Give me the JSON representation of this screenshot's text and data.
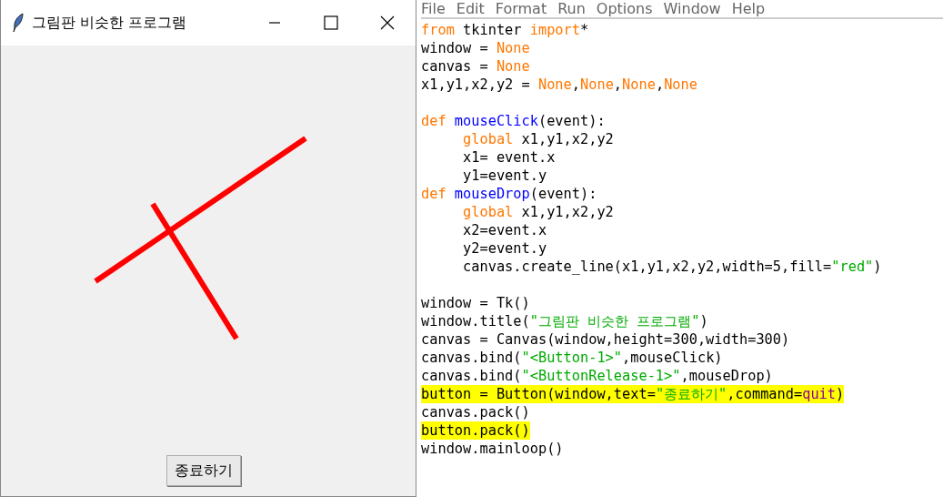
{
  "app_window": {
    "title": "그림판 비슷한 프로그램",
    "quit_button": "종료하기"
  },
  "editor": {
    "menu": [
      "File",
      "Edit",
      "Format",
      "Run",
      "Options",
      "Window",
      "Help"
    ],
    "lines": [
      {
        "kind": "code",
        "highlighted": false,
        "tokens": [
          {
            "kind": "keyword",
            "text": "from"
          },
          {
            "kind": "plain",
            "text": " tkinter "
          },
          {
            "kind": "keyword",
            "text": "import"
          },
          {
            "kind": "plain",
            "text": "*"
          }
        ]
      },
      {
        "kind": "code",
        "highlighted": false,
        "tokens": [
          {
            "kind": "plain",
            "text": "window = "
          },
          {
            "kind": "keyword",
            "text": "None"
          }
        ]
      },
      {
        "kind": "code",
        "highlighted": false,
        "tokens": [
          {
            "kind": "plain",
            "text": "canvas = "
          },
          {
            "kind": "keyword",
            "text": "None"
          }
        ]
      },
      {
        "kind": "code",
        "highlighted": false,
        "tokens": [
          {
            "kind": "plain",
            "text": "x1,y1,x2,y2 = "
          },
          {
            "kind": "keyword",
            "text": "None"
          },
          {
            "kind": "plain",
            "text": ","
          },
          {
            "kind": "keyword",
            "text": "None"
          },
          {
            "kind": "plain",
            "text": ","
          },
          {
            "kind": "keyword",
            "text": "None"
          },
          {
            "kind": "plain",
            "text": ","
          },
          {
            "kind": "keyword",
            "text": "None"
          }
        ]
      },
      {
        "kind": "blank"
      },
      {
        "kind": "code",
        "highlighted": false,
        "tokens": [
          {
            "kind": "keyword",
            "text": "def "
          },
          {
            "kind": "definition",
            "text": "mouseClick"
          },
          {
            "kind": "plain",
            "text": "(event):"
          }
        ]
      },
      {
        "kind": "code",
        "highlighted": false,
        "tokens": [
          {
            "kind": "keyword",
            "text": "     global"
          },
          {
            "kind": "plain",
            "text": " x1,y1,x2,y2"
          }
        ]
      },
      {
        "kind": "code",
        "highlighted": false,
        "tokens": [
          {
            "kind": "plain",
            "text": "     x1= event.x"
          }
        ]
      },
      {
        "kind": "code",
        "highlighted": false,
        "tokens": [
          {
            "kind": "plain",
            "text": "     y1=event.y"
          }
        ]
      },
      {
        "kind": "code",
        "highlighted": false,
        "tokens": [
          {
            "kind": "keyword",
            "text": "def "
          },
          {
            "kind": "definition",
            "text": "mouseDrop"
          },
          {
            "kind": "plain",
            "text": "(event):"
          }
        ]
      },
      {
        "kind": "code",
        "highlighted": false,
        "tokens": [
          {
            "kind": "keyword",
            "text": "     global"
          },
          {
            "kind": "plain",
            "text": " x1,y1,x2,y2"
          }
        ]
      },
      {
        "kind": "code",
        "highlighted": false,
        "tokens": [
          {
            "kind": "plain",
            "text": "     x2=event.x"
          }
        ]
      },
      {
        "kind": "code",
        "highlighted": false,
        "tokens": [
          {
            "kind": "plain",
            "text": "     y2=event.y"
          }
        ]
      },
      {
        "kind": "code",
        "highlighted": false,
        "tokens": [
          {
            "kind": "plain",
            "text": "     canvas.create_line(x1,y1,x2,y2,width=5,fill="
          },
          {
            "kind": "string",
            "text": "\"red\""
          },
          {
            "kind": "plain",
            "text": ")"
          }
        ]
      },
      {
        "kind": "blank"
      },
      {
        "kind": "code",
        "highlighted": false,
        "tokens": [
          {
            "kind": "plain",
            "text": "window = Tk()"
          }
        ]
      },
      {
        "kind": "code",
        "highlighted": false,
        "tokens": [
          {
            "kind": "plain",
            "text": "window.title("
          },
          {
            "kind": "string",
            "text": "\"그림판 비슷한 프로그램\""
          },
          {
            "kind": "plain",
            "text": ")"
          }
        ]
      },
      {
        "kind": "code",
        "highlighted": false,
        "tokens": [
          {
            "kind": "plain",
            "text": "canvas = Canvas(window,height=300,width=300)"
          }
        ]
      },
      {
        "kind": "code",
        "highlighted": false,
        "tokens": [
          {
            "kind": "plain",
            "text": "canvas.bind("
          },
          {
            "kind": "string",
            "text": "\"<Button-1>\""
          },
          {
            "kind": "plain",
            "text": ",mouseClick)"
          }
        ]
      },
      {
        "kind": "code",
        "highlighted": false,
        "tokens": [
          {
            "kind": "plain",
            "text": "canvas.bind("
          },
          {
            "kind": "string",
            "text": "\"<ButtonRelease-1>\""
          },
          {
            "kind": "plain",
            "text": ",mouseDrop)"
          }
        ]
      },
      {
        "kind": "code",
        "highlighted": true,
        "tokens": [
          {
            "kind": "plain",
            "text": "button = Button(window,text="
          },
          {
            "kind": "string",
            "text": "\"종료하기\""
          },
          {
            "kind": "plain",
            "text": ",command="
          },
          {
            "kind": "builtin",
            "text": "quit"
          },
          {
            "kind": "plain",
            "text": ")"
          }
        ]
      },
      {
        "kind": "code",
        "highlighted": false,
        "tokens": [
          {
            "kind": "plain",
            "text": "canvas.pack()"
          }
        ]
      },
      {
        "kind": "code",
        "highlighted": true,
        "tokens": [
          {
            "kind": "plain",
            "text": "button.pack()"
          }
        ]
      },
      {
        "kind": "code",
        "highlighted": false,
        "tokens": [
          {
            "kind": "plain",
            "text": "window.mainloop()"
          }
        ]
      }
    ]
  }
}
